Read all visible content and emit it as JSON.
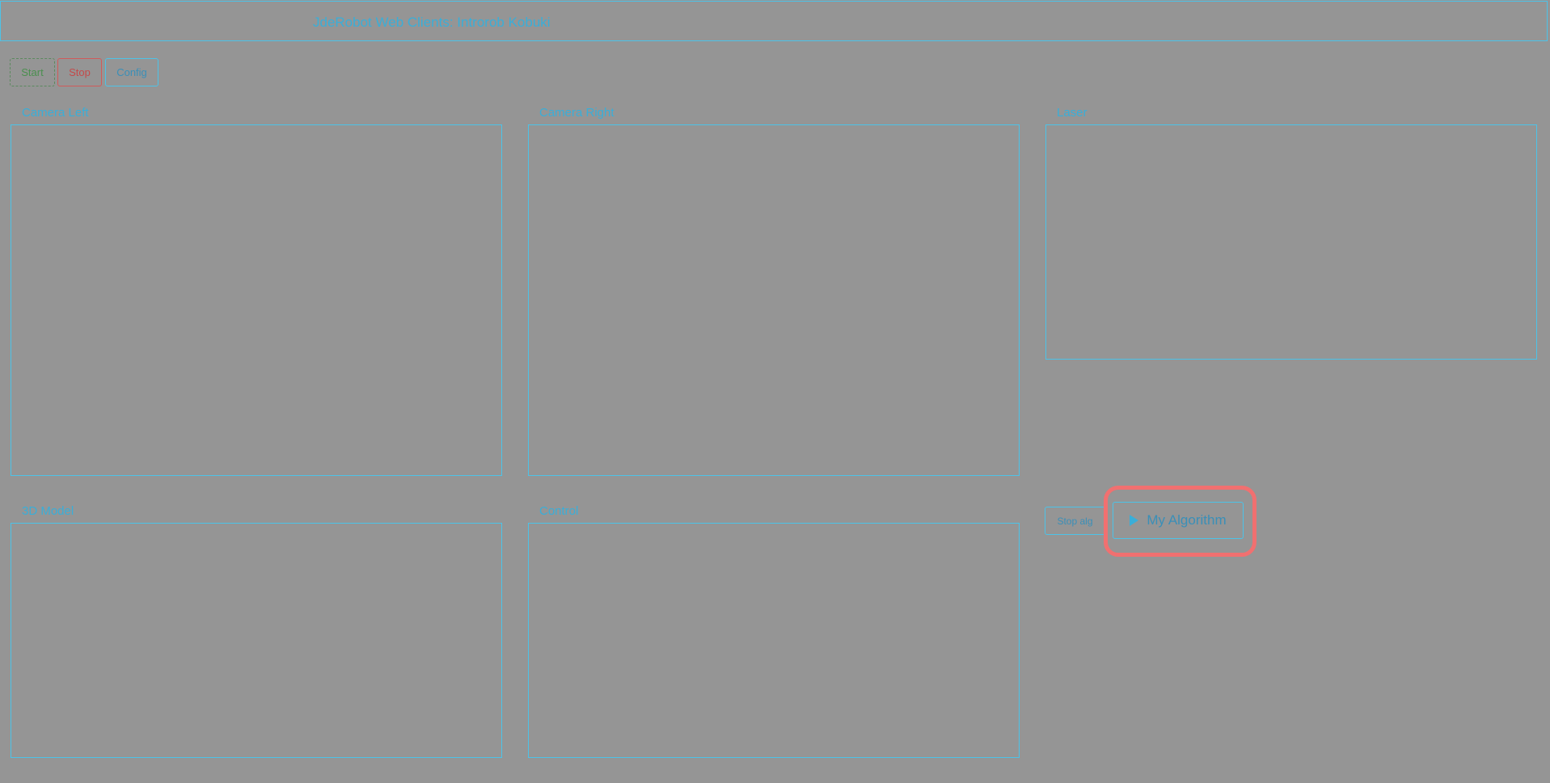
{
  "header": {
    "title": "JdeRobot Web Clients: Introrob Kobuki"
  },
  "toolbar": {
    "start_label": "Start",
    "stop_label": "Stop",
    "config_label": "Config"
  },
  "panels": {
    "camera_left": "Camera Left",
    "camera_right": "Camera Right",
    "laser": "Laser",
    "model_3d": "3D Model",
    "control": "Control"
  },
  "algorithm": {
    "stop_label": "Stop alg",
    "run_label": "My Algorithm",
    "run_icon": "play-icon"
  },
  "colors": {
    "background": "#959595",
    "accent": "#4cc3e8",
    "start": "#4b8f4f",
    "stop": "#c44a4a",
    "highlight": "#f17070"
  }
}
